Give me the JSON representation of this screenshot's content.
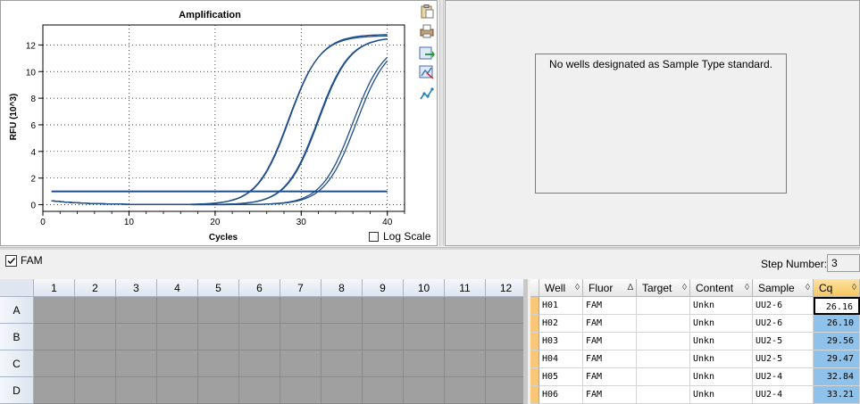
{
  "chart": {
    "title": "Amplification",
    "xlabel": "Cycles",
    "ylabel": "RFU (10^3)",
    "x_ticks": [
      "0",
      "10",
      "20",
      "30",
      "40"
    ],
    "y_ticks": [
      "0",
      "2",
      "4",
      "6",
      "8",
      "10",
      "12"
    ],
    "log_scale_label": "Log Scale",
    "log_scale_checked": false,
    "line_color": "#1f4e8c"
  },
  "chart_data": {
    "type": "line",
    "title": "Amplification",
    "xlabel": "Cycles",
    "ylabel": "RFU (10^3)",
    "xlim": [
      0,
      42
    ],
    "ylim": [
      -0.5,
      13.5
    ],
    "grid": true,
    "threshold": 1.0,
    "series": [
      {
        "well": "H01",
        "cq": 26.16,
        "plateau": 12.8,
        "mid": 28.6
      },
      {
        "well": "H02",
        "cq": 26.1,
        "plateau": 12.7,
        "mid": 28.5
      },
      {
        "well": "H03",
        "cq": 29.56,
        "plateau": 12.6,
        "mid": 32.0
      },
      {
        "well": "H04",
        "cq": 29.47,
        "plateau": 12.6,
        "mid": 31.9
      },
      {
        "well": "H05",
        "cq": 32.84,
        "plateau": 12.3,
        "mid": 36.0
      },
      {
        "well": "H06",
        "cq": 33.21,
        "plateau": 12.3,
        "mid": 36.4
      }
    ]
  },
  "toolbar_icons": [
    "clipboard-icon",
    "print-icon",
    "export-icon",
    "zoom-icon",
    "chart-style-icon"
  ],
  "std_curve": {
    "message": "No wells designated as Sample Type standard."
  },
  "fluor_filter": {
    "label": "FAM",
    "checked": true
  },
  "step": {
    "label": "Step Number:",
    "value": "3"
  },
  "plate": {
    "columns": [
      "1",
      "2",
      "3",
      "4",
      "5",
      "6",
      "7",
      "8",
      "9",
      "10",
      "11",
      "12"
    ],
    "rows": [
      "A",
      "B",
      "C",
      "D"
    ]
  },
  "results": {
    "columns": [
      {
        "label": "Well",
        "sort": "◊"
      },
      {
        "label": "Fluor",
        "sort": "∆"
      },
      {
        "label": "Target",
        "sort": "◊"
      },
      {
        "label": "Content",
        "sort": "◊"
      },
      {
        "label": "Sample",
        "sort": "◊"
      },
      {
        "label": "Cq",
        "sort": "◊"
      }
    ],
    "rows": [
      {
        "well": "H01",
        "fluor": "FAM",
        "target": "",
        "content": "Unkn",
        "sample": "UU2-6",
        "cq": "26.16"
      },
      {
        "well": "H02",
        "fluor": "FAM",
        "target": "",
        "content": "Unkn",
        "sample": "UU2-6",
        "cq": "26.10"
      },
      {
        "well": "H03",
        "fluor": "FAM",
        "target": "",
        "content": "Unkn",
        "sample": "UU2-5",
        "cq": "29.56"
      },
      {
        "well": "H04",
        "fluor": "FAM",
        "target": "",
        "content": "Unkn",
        "sample": "UU2-5",
        "cq": "29.47"
      },
      {
        "well": "H05",
        "fluor": "FAM",
        "target": "",
        "content": "Unkn",
        "sample": "UU2-4",
        "cq": "32.84"
      },
      {
        "well": "H06",
        "fluor": "FAM",
        "target": "",
        "content": "Unkn",
        "sample": "UU2-4",
        "cq": "33.21"
      }
    ]
  }
}
